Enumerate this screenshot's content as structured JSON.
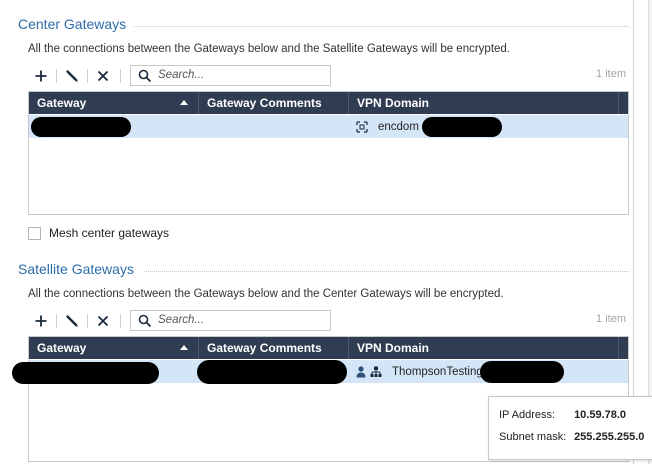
{
  "center": {
    "title": "Center Gateways",
    "description": "All the connections between the Gateways below and the Satellite Gateways will be encrypted.",
    "search_placeholder": "Search...",
    "count": "1 item",
    "columns": [
      "Gateway",
      "Gateway Comments",
      "VPN Domain"
    ],
    "rows": [
      {
        "gateway": "",
        "comments": "",
        "vpn_domain": "encdom"
      }
    ]
  },
  "mesh": {
    "label": "Mesh center gateways",
    "checked": false
  },
  "satellite": {
    "title": "Satellite Gateways",
    "description": "All the connections between the Gateways below and the Center Gateways will be encrypted.",
    "search_placeholder": "Search...",
    "count": "1 item",
    "columns": [
      "Gateway",
      "Gateway Comments",
      "VPN Domain"
    ],
    "rows": [
      {
        "gateway": "",
        "comments": "",
        "vpn_domain": "ThompsonTesting"
      }
    ]
  },
  "tooltip": {
    "ip_label": "IP Address:",
    "ip_value": "10.59.78.0",
    "mask_label": "Subnet mask:",
    "mask_value": "255.255.255.0"
  },
  "icons": {
    "add": "plus-icon",
    "edit": "pencil-icon",
    "remove": "x-icon",
    "search": "magnifier-icon",
    "sort": "sort-ascending-icon",
    "encdom": "group-network-icon",
    "sat_vpn": "user-network-icon"
  },
  "colors": {
    "section_title": "#2e6ca8",
    "header_bg": "#2f3c52",
    "row_selected": "#d3e5f7"
  }
}
